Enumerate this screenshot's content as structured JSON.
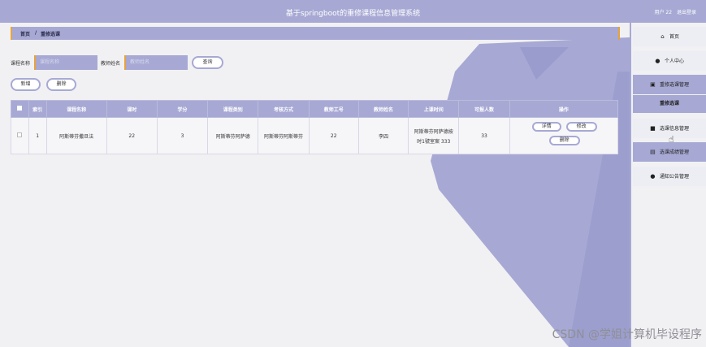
{
  "header": {
    "app_title": "基于springboot的重修课程信息管理系统",
    "user_label": "用户 22",
    "logout_label": "退出登录"
  },
  "breadcrumb": {
    "home": "首页",
    "separator": "/",
    "current": "重修选课"
  },
  "search": {
    "course_name_label": "课程名称",
    "course_name_placeholder": "课程名称",
    "teacher_name_label": "教师姓名",
    "teacher_name_placeholder": "教师姓名",
    "query_button": "查询"
  },
  "actions": {
    "add_button": "新增",
    "delete_button": "删除"
  },
  "table": {
    "columns": [
      "索引",
      "课程名称",
      "课时",
      "学分",
      "课程类别",
      "考核方式",
      "教师工号",
      "教师姓名",
      "上课时间",
      "可报人数",
      "操作"
    ],
    "rows": [
      {
        "index": "1",
        "course_name": "阿斯蒂芬撒旦法",
        "hours": "22",
        "credits": "3",
        "category": "阿斯蒂芬阿萨德",
        "assessment": "阿斯蒂芬阿斯蒂芬",
        "teacher_id": "22",
        "teacher_name": "李四",
        "schedule_line1": "阿斯蒂芬阿萨德按",
        "schedule_line2": "时1號室案 333",
        "capacity": "33",
        "ops": {
          "detail": "详情",
          "edit": "修改",
          "delete": "删除"
        }
      }
    ]
  },
  "sidebar": {
    "items": [
      {
        "label": "首页",
        "icon": "home-icon"
      },
      {
        "label": "个人中心",
        "icon": "user-icon"
      },
      {
        "label": "重修选课管理",
        "icon": "bag-icon"
      },
      {
        "label": "重修选课",
        "icon": ""
      },
      {
        "label": "选课信息管理",
        "icon": "monitor-icon"
      },
      {
        "label": "选课成绩管理",
        "icon": "printer-icon"
      },
      {
        "label": "通知公告管理",
        "icon": "pin-icon"
      }
    ]
  },
  "watermark": "CSDN @学姐计算机毕设程序",
  "colors": {
    "primary": "#a7a9d4",
    "accent": "#e6a33c",
    "background": "#f1f1f4"
  }
}
